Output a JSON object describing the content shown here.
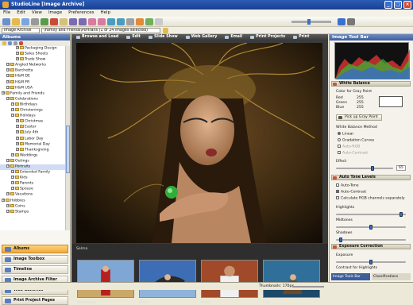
{
  "window": {
    "title": "StudioLine [Image Archive]"
  },
  "menu": [
    "File",
    "Edit",
    "View",
    "Image",
    "Preferences",
    "Help"
  ],
  "address": {
    "view_combo": "Image Archive",
    "path_combo": "\\Family and Friends\\Portraits (1 of 24 images selected)"
  },
  "albums": {
    "header": "Albums",
    "tree": [
      {
        "level": 3,
        "label": "Packaging Design"
      },
      {
        "level": 3,
        "label": "Sales Sheets"
      },
      {
        "level": 3,
        "label": "Trade Show"
      },
      {
        "level": 1,
        "label": "Angled Networks"
      },
      {
        "level": 1,
        "label": "Barchetta"
      },
      {
        "level": 1,
        "label": "H&M DE"
      },
      {
        "level": 1,
        "label": "H&M FR"
      },
      {
        "level": 1,
        "label": "H&M USA"
      },
      {
        "level": 0,
        "label": "Family and Friends"
      },
      {
        "level": 1,
        "label": "Celebrations"
      },
      {
        "level": 2,
        "label": "Birthdays"
      },
      {
        "level": 2,
        "label": "Christenings"
      },
      {
        "level": 2,
        "label": "Holidays"
      },
      {
        "level": 3,
        "label": "Christmas"
      },
      {
        "level": 3,
        "label": "Easter"
      },
      {
        "level": 3,
        "label": "July 4th"
      },
      {
        "level": 3,
        "label": "Labor Day"
      },
      {
        "level": 3,
        "label": "Memorial Day"
      },
      {
        "level": 3,
        "label": "Thanksgiving"
      },
      {
        "level": 2,
        "label": "Weddings"
      },
      {
        "level": 1,
        "label": "Outings"
      },
      {
        "level": 1,
        "label": "Portraits"
      },
      {
        "level": 2,
        "label": "Extended Family"
      },
      {
        "level": 2,
        "label": "Kids"
      },
      {
        "level": 2,
        "label": "Parents"
      },
      {
        "level": 2,
        "label": "Spouse"
      },
      {
        "level": 1,
        "label": "Vacations"
      },
      {
        "level": 0,
        "label": "Hobbies"
      },
      {
        "level": 1,
        "label": "Coins"
      },
      {
        "level": 1,
        "label": "Stamps"
      }
    ],
    "nav": [
      {
        "label": "Albums",
        "active": true
      },
      {
        "label": "Image Toolbox",
        "active": false
      },
      {
        "label": "Timeline",
        "active": false
      },
      {
        "label": "Image Archive Filter",
        "active": false
      },
      {
        "label": "Web Galleries",
        "active": false
      },
      {
        "label": "Print Project Pages",
        "active": false
      }
    ]
  },
  "view_tabs": [
    "Browse and Load",
    "Edit",
    "Slide Show",
    "Web Gallery",
    "Email",
    "Print Projects",
    "Print"
  ],
  "preview": {
    "caption": "Selma"
  },
  "thumbnails": [
    {
      "label": "Madeleine"
    },
    {
      "label": "Petra"
    },
    {
      "label": "Brad"
    },
    {
      "label": "Eva"
    }
  ],
  "tool_bar": {
    "header": "Image Tool Bar",
    "white_balance": {
      "title": "White Balance",
      "color_for_gray_point": "Color for Gray Point",
      "red_label": "Red",
      "red": "255",
      "green_label": "Green",
      "green": "255",
      "blue_label": "Blue",
      "blue": "255",
      "pick_button": "Pick up Gray Point",
      "method_label": "White Balance Method",
      "methods": [
        "Linear",
        "Gradation Curves",
        "Auto-RGB",
        "Auto-Contrast"
      ],
      "selected_method": "Linear",
      "effect_label": "Effect",
      "effect_value": "65"
    },
    "auto_tone": {
      "title": "Auto Tone Levels",
      "options": [
        {
          "label": "Auto-Tone",
          "checked": false
        },
        {
          "label": "Auto-Contrast",
          "checked": true
        },
        {
          "label": "Calculate RGB channels separately",
          "checked": false
        }
      ],
      "highlights_label": "Highlights",
      "midtones_label": "Midtones",
      "shadows_label": "Shadows"
    },
    "exposure": {
      "title": "Exposure Correction",
      "exposure_label": "Exposure",
      "contrast_label": "Contrast for Highlights"
    },
    "tabs": [
      "Image Tools Bar",
      "Classifications"
    ]
  },
  "status": {
    "zoom": "Thumbnails: 170px"
  },
  "colors": {
    "accent": "#f0a93b",
    "titlebar": "#1a3f8f",
    "panel_header": "#3e5e9c"
  }
}
